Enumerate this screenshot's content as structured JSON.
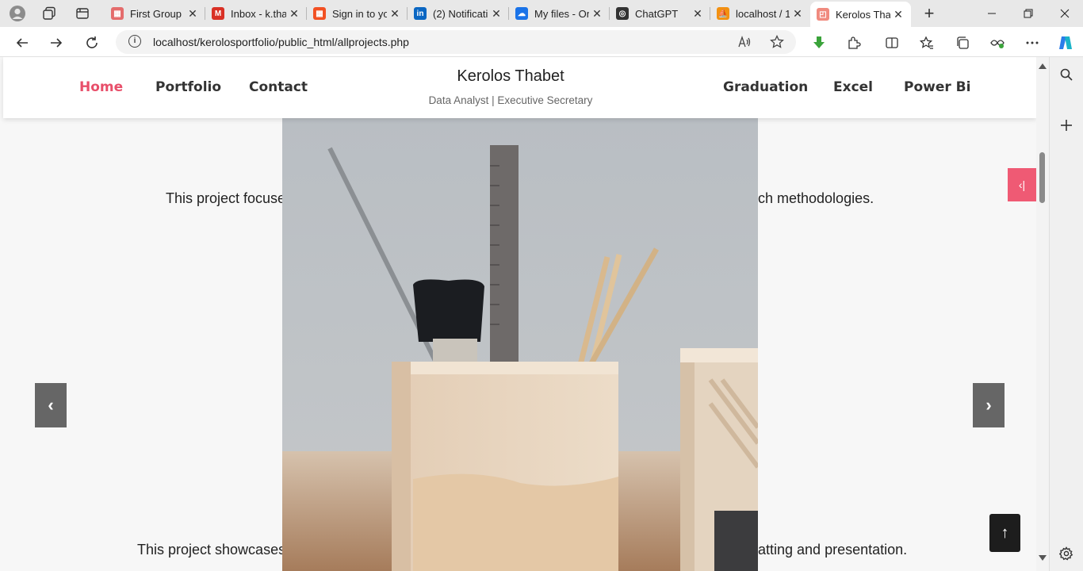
{
  "browser": {
    "tabs": [
      {
        "label": "First Group -",
        "favicon_color": "#e46c6c"
      },
      {
        "label": "Inbox - k.tha",
        "favicon_color": "#d93025"
      },
      {
        "label": "Sign in to yo",
        "favicon_color": "#f25022"
      },
      {
        "label": "(2) Notificati",
        "favicon_color": "#0a66c2"
      },
      {
        "label": "My files - On",
        "favicon_color": "#1a73e8"
      },
      {
        "label": "ChatGPT",
        "favicon_color": "#333333"
      },
      {
        "label": "localhost / 1",
        "favicon_color": "#f29111"
      },
      {
        "label": "Kerolos Thab",
        "favicon_color": "#f08a7e"
      }
    ],
    "favicon_letters": [
      "▦",
      "M",
      "▦",
      "in",
      "☁",
      "◎",
      "⛵",
      "◰"
    ],
    "close_glyph": "✕",
    "new_tab_glyph": "+",
    "url": "localhost/kerolosportfolio/public_html/allprojects.php"
  },
  "nav": {
    "home": "Home",
    "portfolio": "Portfolio",
    "contact": "Contact",
    "graduation": "Graduation",
    "excel": "Excel",
    "power_bi": "Power Bi"
  },
  "brand": {
    "name": "Kerolos Thabet",
    "tagline": "Data Analyst | Executive Secretary"
  },
  "content": {
    "project1_left": "This project focuse",
    "project1_right": "ch methodologies.",
    "project2_left": "This project showcases",
    "project2_right": "atting and presentation."
  },
  "controls": {
    "prev": "‹",
    "next": "›",
    "toggle": "‹|",
    "to_top": "↑"
  },
  "colors": {
    "accent": "#e84f6a",
    "toggle": "#ef5a74"
  }
}
